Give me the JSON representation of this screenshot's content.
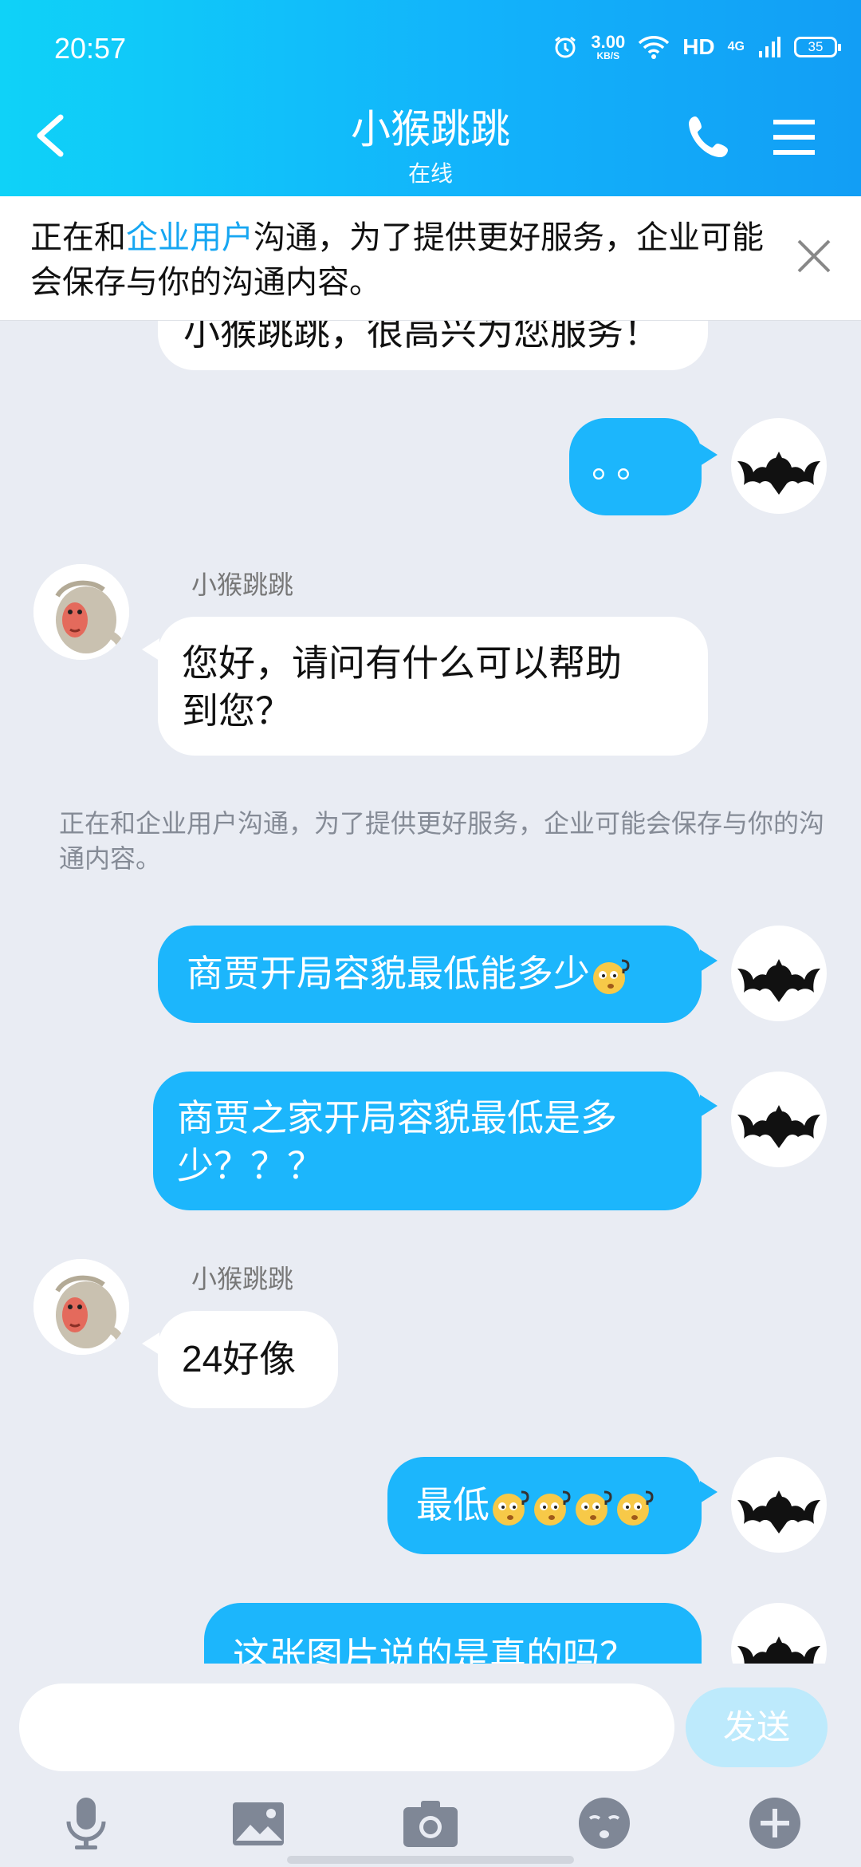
{
  "status_bar": {
    "time": "20:57",
    "net_speed": "3.00",
    "net_unit": "KB/S",
    "hd": "HD",
    "network": "4G",
    "battery": "35"
  },
  "header": {
    "name": "小猴跳跳",
    "status": "在线"
  },
  "notice": {
    "prefix": "正在和",
    "link": "企业用户",
    "suffix": "沟通，为了提供更好服务，企业可能会保存与你的沟通内容。"
  },
  "messages": {
    "recv_partial": "小猴跳跳，很高兴为您服务！",
    "sent_dots": "。。",
    "sender1": "小猴跳跳",
    "recv1": [
      "您好，请问有什么可以帮助",
      "到您？"
    ],
    "system": "正在和企业用户沟通，为了提供更好服务，企业可能会保存与你的沟通内容。",
    "sent1": "商贾开局容貌最低能多少",
    "sent2": [
      "商贾之家开局容貌最低是多",
      "少？？？"
    ],
    "sender2": "小猴跳跳",
    "recv2": "24好像",
    "sent3": "最低",
    "sent4": "这张图片说的是真的吗？"
  },
  "input": {
    "placeholder": "",
    "send_label": "发送"
  },
  "toolbar": [
    "microphone-icon",
    "image-icon",
    "camera-icon",
    "emoji-icon",
    "plus-icon"
  ],
  "colors": {
    "header_from": "#0fd2f8",
    "header_to": "#129ef5",
    "sent_bubble": "#1cb6fc",
    "link": "#16a6f2",
    "background": "#e9ecf3"
  }
}
